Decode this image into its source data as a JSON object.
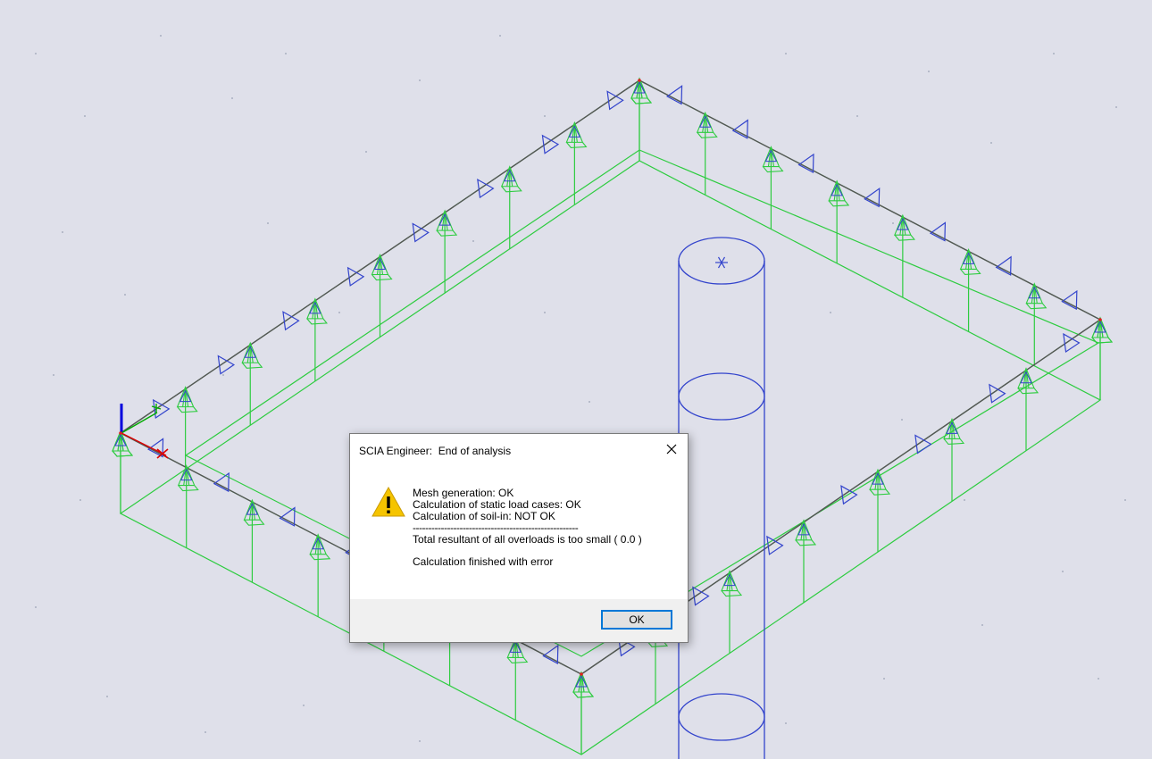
{
  "dialog": {
    "title": "SCIA Engineer:  End of analysis",
    "icon": "warning-icon",
    "messages": [
      "Mesh generation: OK",
      "Calculation of static load cases: OK",
      "Calculation of soil-in: NOT OK"
    ],
    "separator": "-----------------------------------------------------",
    "error_detail": "Total resultant of all overloads is too small ( 0.0 )",
    "summary": "Calculation finished with error",
    "ok_label": "OK"
  },
  "colors": {
    "viewport_background": "#dfe0ea",
    "member_edge": "#555555",
    "surface_lines": "#2ecc40",
    "supports": "#3344cc",
    "column": "#3344cc",
    "node_points": "#e02020",
    "axis_z": "#0000dd",
    "axis_y": "#00aa00",
    "axis_x": "#dd0000"
  }
}
